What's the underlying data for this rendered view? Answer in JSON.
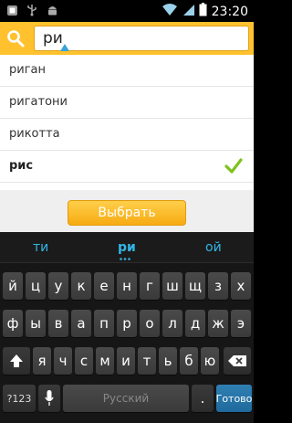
{
  "status_bar": {
    "time": "23:20",
    "left_icons": [
      "app-icon",
      "usb-icon",
      "android-icon"
    ],
    "right_icons": [
      "wifi-icon",
      "signal-icon",
      "battery-icon"
    ]
  },
  "search": {
    "query": "ри",
    "accent_color": "#ffc22e"
  },
  "results": [
    {
      "label": "риган",
      "selected": false
    },
    {
      "label": "ригатони",
      "selected": false
    },
    {
      "label": "рикотта",
      "selected": false
    },
    {
      "label": "рис",
      "selected": true
    }
  ],
  "action": {
    "choose_label": "Выбрать"
  },
  "keyboard": {
    "suggestions": [
      "ти",
      "ри",
      "ой"
    ],
    "row1": [
      "й",
      "ц",
      "у",
      "к",
      "е",
      "н",
      "г",
      "ш",
      "щ",
      "з",
      "х"
    ],
    "row2": [
      "ф",
      "ы",
      "в",
      "а",
      "п",
      "р",
      "о",
      "л",
      "д",
      "ж",
      "э"
    ],
    "row3": [
      "я",
      "ч",
      "с",
      "м",
      "и",
      "т",
      "ь",
      "б",
      "ю"
    ],
    "symbols_label": "?123",
    "space_label": "Русский",
    "period_label": ".",
    "done_label": "Готово"
  }
}
